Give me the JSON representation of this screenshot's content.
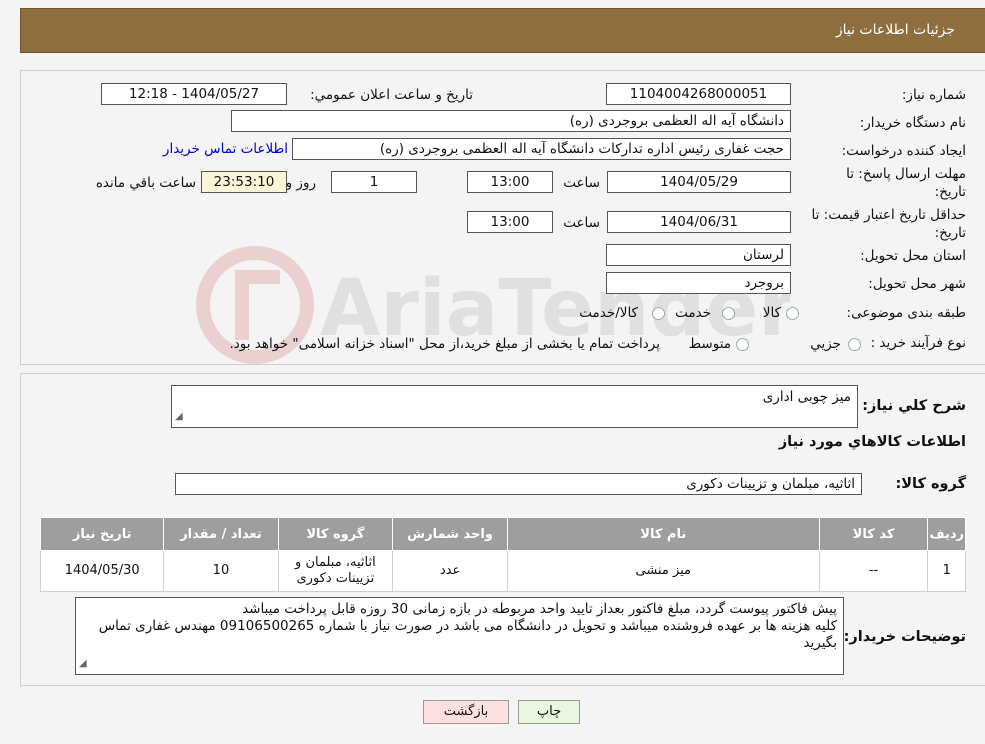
{
  "header": {
    "title": "جزئیات اطلاعات نیاز"
  },
  "form": {
    "need_number_label": "شماره نیاز:",
    "need_number": "1104004268000051",
    "announce_label": "تاریخ و ساعت اعلان عمومي:",
    "announce_value": "1404/05/27 - 12:18",
    "buyer_org_label": "نام دستگاه خریدار:",
    "buyer_org": "دانشگاه آیه اله العظمی بروجردی (ره)",
    "creator_label": "ایجاد کننده درخواست:",
    "creator": "حجت غفاری رئیس اداره تدارکات  دانشگاه آیه اله العظمی بروجردی (ره)",
    "contact_link": "اطلاعات تماس خریدار",
    "reply_deadline_label": "مهلت ارسال پاسخ: تا",
    "reply_deadline_label2": "تاریخ:",
    "reply_date": "1404/05/29",
    "time_label": "ساعت",
    "reply_time": "13:00",
    "days_value": "1",
    "days_label": "روز و",
    "remaining_value": "23:53:10",
    "remaining_label": "ساعت باقي مانده",
    "price_validity_label": "حداقل تاریخ اعتبار قیمت: تا",
    "price_validity_label2": "تاریخ:",
    "price_date": "1404/06/31",
    "price_time": "13:00",
    "province_label": "استان محل تحویل:",
    "province": "لرستان",
    "city_label": "شهر محل تحویل:",
    "city": "بروجرد",
    "category_label": "طبقه بندی موضوعی:",
    "category_options": [
      "کالا",
      "خدمت",
      "کالا/خدمت"
    ],
    "process_label": "نوع فرآیند خرید :",
    "process_options": [
      "جزیي",
      "متوسط"
    ],
    "process_note": "پرداخت تمام یا بخشی از مبلغ خرید،از محل \"اسناد خزانه اسلامی\" خواهد بود."
  },
  "details": {
    "summary_label": "شرح کلي نیاز:",
    "summary": "میز چوبی اداری",
    "goods_info_title": "اطلاعات کالاهاي مورد نیاز",
    "group_label": "گروه کالا:",
    "group_value": "اثاثیه، مبلمان و تزیینات دکوری",
    "table": {
      "headers": [
        "ردیف",
        "کد کالا",
        "نام کالا",
        "واحد شمارش",
        "گروه کالا",
        "تعداد / مقدار",
        "تاریخ نیاز"
      ],
      "rows": [
        [
          "1",
          "--",
          "میز منشی",
          "عدد",
          "اثاثیه، مبلمان و تزیینات دکوری",
          "10",
          "1404/05/30"
        ]
      ]
    },
    "buyer_notes_label": "توضیحات خریدار:",
    "buyer_notes_line1": "پیش فاکتور پیوست گردد، مبلغ فاکتور بعداز تایید واحد مربوطه در بازه زمانی 30 روزه قابل پرداخت میباشد",
    "buyer_notes_line2": "کلیه هزینه ها بر عهده فروشنده میباشد و تحویل در دانشگاه می باشد در صورت نیاز با شماره 09106500265 مهندس غفاری تماس بگیرید"
  },
  "buttons": {
    "print": "چاپ",
    "back": "بازگشت"
  },
  "watermark": "AriaTender.neT",
  "colors": {
    "header_bg": "#8e6d3f",
    "table_header_bg": "#9e9e9e",
    "back_button_bg": "#fde0e0",
    "print_button_bg": "#e9f7e0",
    "link": "#0000cc"
  }
}
